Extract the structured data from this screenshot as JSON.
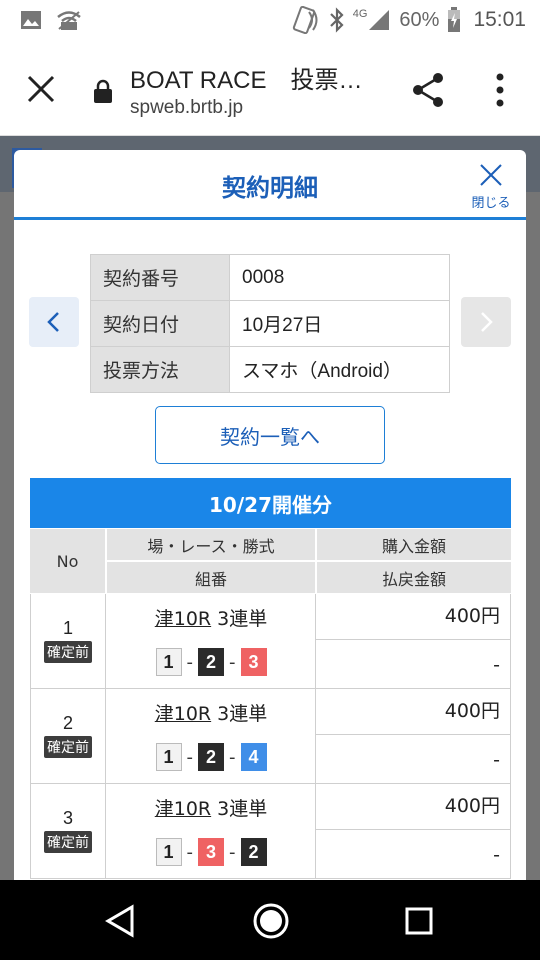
{
  "status_bar": {
    "battery_pct": "60%",
    "time": "15:01",
    "network": "4G",
    "icons": [
      "image-icon",
      "wifi-off-icon",
      "nfc-icon",
      "bluetooth-icon",
      "signal-icon",
      "battery-icon"
    ]
  },
  "browser": {
    "title": "BOAT RACE　投票…",
    "url": "spweb.brtb.jp",
    "icons": [
      "close-icon",
      "lock-icon",
      "share-icon",
      "more-vert-icon"
    ]
  },
  "modal": {
    "title": "契約明細",
    "close_label": "閉じる",
    "info": [
      {
        "label": "契約番号",
        "value": "0008"
      },
      {
        "label": "契約日付",
        "value": "10月27日"
      },
      {
        "label": "投票方法",
        "value": "スマホ（Android）"
      }
    ],
    "list_button": "契約一覧へ",
    "date_banner": "10/27開催分",
    "table_header": {
      "no": "No",
      "race_type": "場・レース・勝式",
      "combo": "組番",
      "purchase": "購入金額",
      "refund": "払戻金額"
    },
    "rows": [
      {
        "no": "1",
        "status": "確定前",
        "venue_race": "津10R",
        "bet_type": "3連単",
        "combo": [
          {
            "n": "1",
            "bg": "#f2f2f2",
            "fg": "#222222"
          },
          {
            "n": "2",
            "bg": "#2b2b2b",
            "fg": "#ffffff"
          },
          {
            "n": "3",
            "bg": "#ef6263",
            "fg": "#ffffff"
          }
        ],
        "purchase": "400円",
        "refund": "-"
      },
      {
        "no": "2",
        "status": "確定前",
        "venue_race": "津10R",
        "bet_type": "3連単",
        "combo": [
          {
            "n": "1",
            "bg": "#f2f2f2",
            "fg": "#222222"
          },
          {
            "n": "2",
            "bg": "#2b2b2b",
            "fg": "#ffffff"
          },
          {
            "n": "4",
            "bg": "#3f8ee8",
            "fg": "#ffffff"
          }
        ],
        "purchase": "400円",
        "refund": "-"
      },
      {
        "no": "3",
        "status": "確定前",
        "venue_race": "津10R",
        "bet_type": "3連単",
        "combo": [
          {
            "n": "1",
            "bg": "#f2f2f2",
            "fg": "#222222"
          },
          {
            "n": "3",
            "bg": "#ef6263",
            "fg": "#ffffff"
          },
          {
            "n": "2",
            "bg": "#2b2b2b",
            "fg": "#ffffff"
          }
        ],
        "purchase": "400円",
        "refund": "-"
      }
    ],
    "combo_separator": "-"
  },
  "colors": {
    "accent": "#1a86e8",
    "title_blue": "#1c5fb8",
    "header_gray": "#e3e3e3"
  }
}
